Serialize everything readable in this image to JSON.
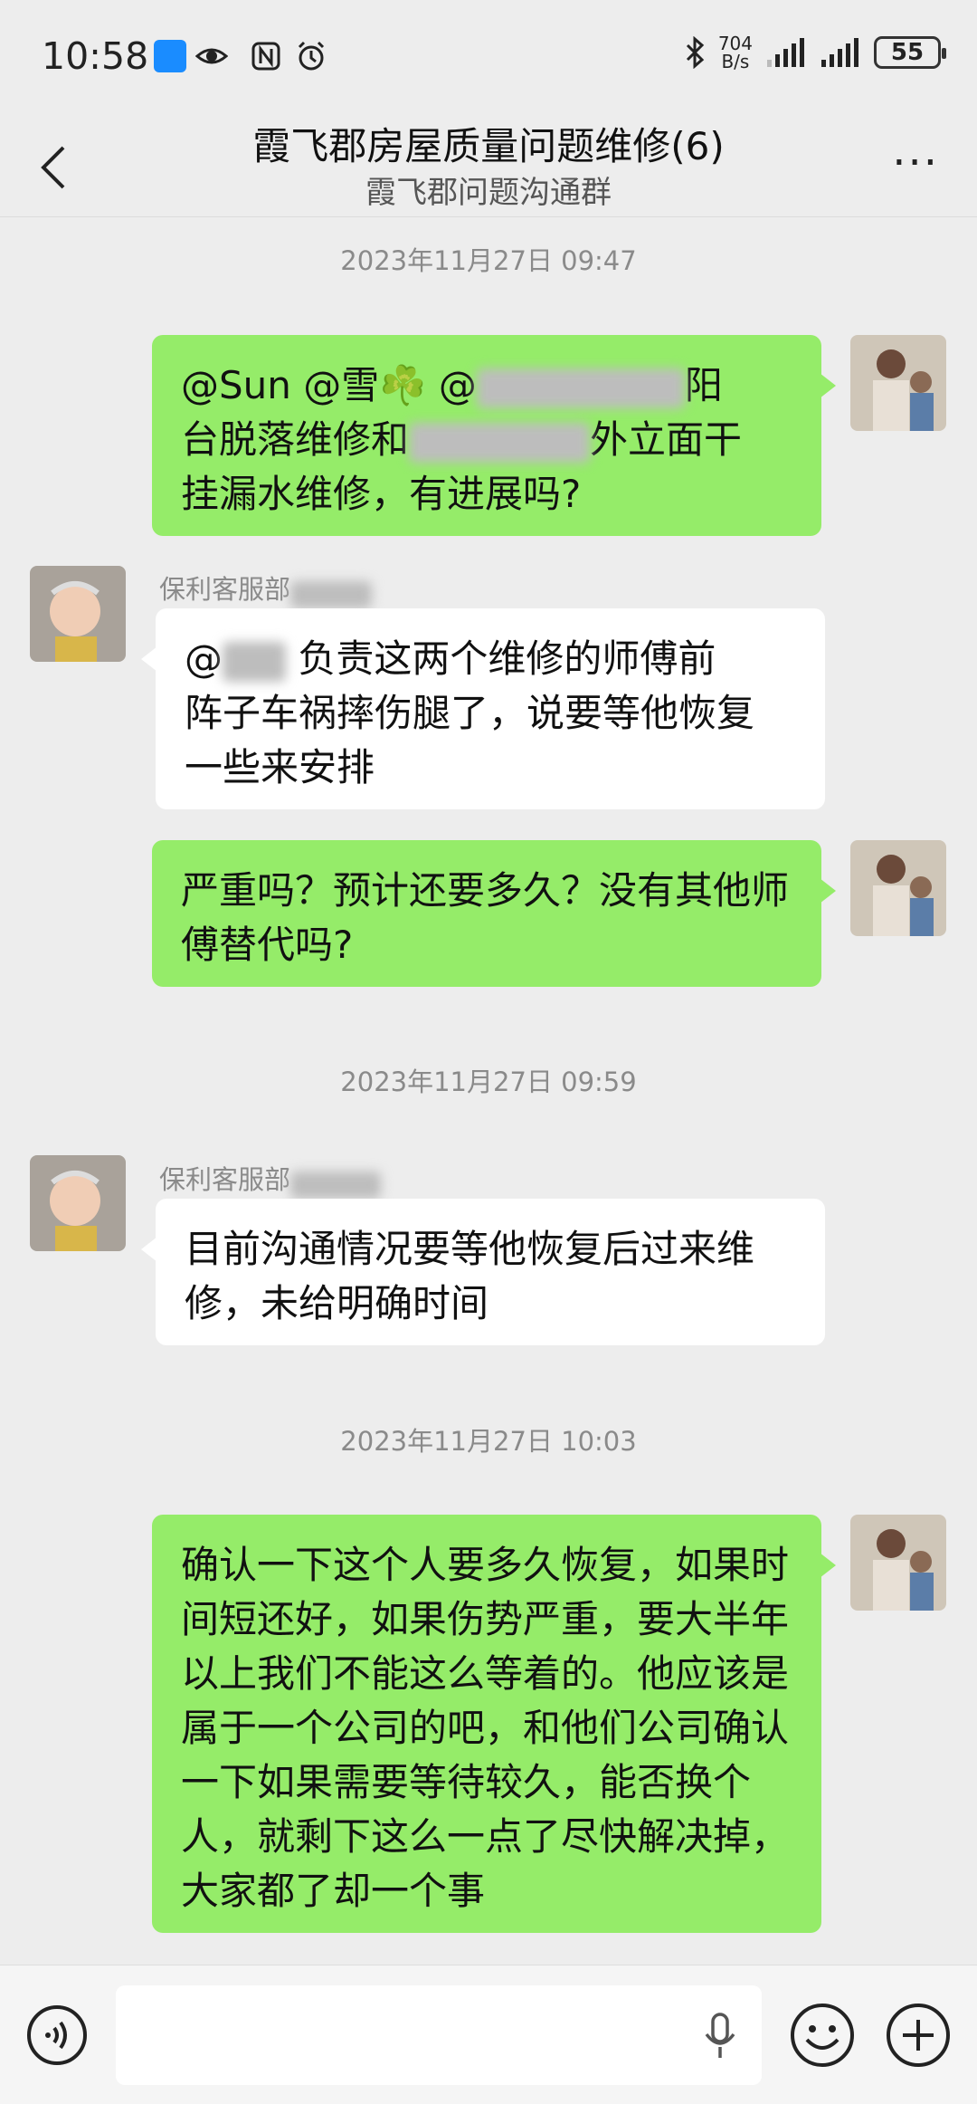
{
  "status_bar": {
    "time": "10:58",
    "net_speed_value": "704",
    "net_speed_unit": "B/s",
    "battery": "55"
  },
  "header": {
    "title": "霞飞郡房屋质量问题维修(6)",
    "subtitle": "霞飞郡问题沟通群"
  },
  "messages": {
    "ts1": "2023年11月27日 09:47",
    "m1": {
      "line1": "@Sun @雪☘️ @",
      "line1_tail": "阳",
      "line2_head": "台脱落维修和",
      "line2_tail": "外立面干",
      "line3": "挂漏水维修，有进展吗?"
    },
    "m2": {
      "sender": "保利客服部",
      "head": "@",
      "text1": "负责这两个维修的师傅前",
      "text2": "阵子车祸摔伤腿了，说要等他恢复",
      "text3": "一些来安排"
    },
    "m3": {
      "text": "严重吗？预计还要多久？没有其他师傅替代吗?"
    },
    "ts2": "2023年11月27日 09:59",
    "m4": {
      "sender": "保利客服部",
      "text": "目前沟通情况要等他恢复后过来维修，未给明确时间"
    },
    "ts3": "2023年11月27日 10:03",
    "m5": {
      "text": "确认一下这个人要多久恢复，如果时间短还好，如果伤势严重，要大半年以上我们不能这么等着的。他应该是属于一个公司的吧，和他们公司确认一下如果需要等待较久，能否换个人，就剩下这么一点了尽快解决掉，大家都了却一个事"
    }
  },
  "icons": {
    "voice": "voice-icon",
    "mic": "mic-icon",
    "emoji": "emoji-icon",
    "plus": "plus-icon",
    "back": "back-icon",
    "more": "more-icon"
  },
  "colors": {
    "bubble_green": "#95ec69",
    "bubble_white": "#ffffff",
    "background": "#ededed"
  }
}
